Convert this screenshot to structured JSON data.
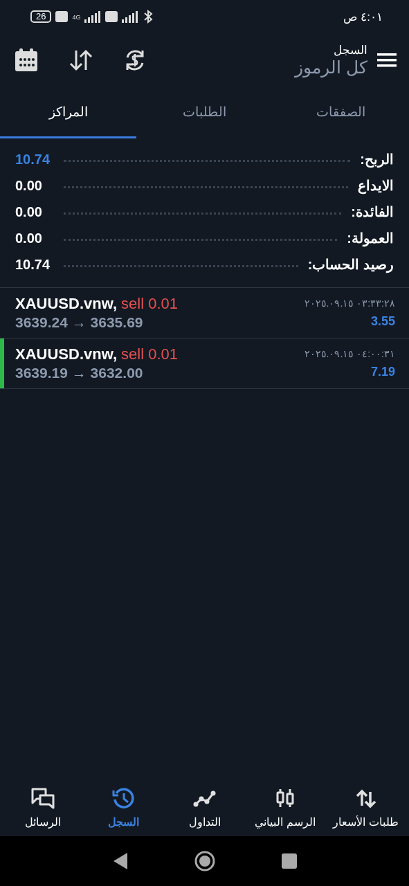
{
  "status_bar": {
    "time": "٤:٠١ ص",
    "battery": "26",
    "network": "4G"
  },
  "header": {
    "title": "السجل",
    "subtitle": "كل الرموز"
  },
  "tabs": [
    {
      "label": "الصفقات",
      "selected": false
    },
    {
      "label": "الطلبات",
      "selected": false
    },
    {
      "label": "المراكز",
      "selected": true
    }
  ],
  "summary": [
    {
      "label": "الربح:",
      "value": "10.74",
      "highlighted": true
    },
    {
      "label": "الايداع",
      "value": "0.00",
      "highlighted": false
    },
    {
      "label": "الفائدة:",
      "value": "0.00",
      "highlighted": false
    },
    {
      "label": "العمولة:",
      "value": "0.00",
      "highlighted": false
    },
    {
      "label": "رصيد الحساب:",
      "value": "10.74",
      "highlighted": false
    }
  ],
  "positions": [
    {
      "symbol": "XAUUSD.vnw,",
      "side": "sell 0.01",
      "prices": "3639.24 → 3635.69",
      "time": "٠٣:٣٣:٢٨ ٢٠٢٥.٠٩.١٥",
      "profit": "3.55",
      "selected": false
    },
    {
      "symbol": "XAUUSD.vnw,",
      "side": "sell 0.01",
      "prices": "3639.19 → 3632.00",
      "time": "٠٤:٠٠:٣١ ٢٠٢٥.٠٩.١٥",
      "profit": "7.19",
      "selected": true
    }
  ],
  "bottom_nav": [
    {
      "label": "طلبات الأسعار",
      "kind": "quotes",
      "selected": false
    },
    {
      "label": "الرسم البياني",
      "kind": "chart",
      "selected": false
    },
    {
      "label": "التداول",
      "kind": "trade",
      "selected": false
    },
    {
      "label": "السجل",
      "kind": "history",
      "selected": true
    },
    {
      "label": "الرسائل",
      "kind": "messages",
      "selected": false
    }
  ]
}
